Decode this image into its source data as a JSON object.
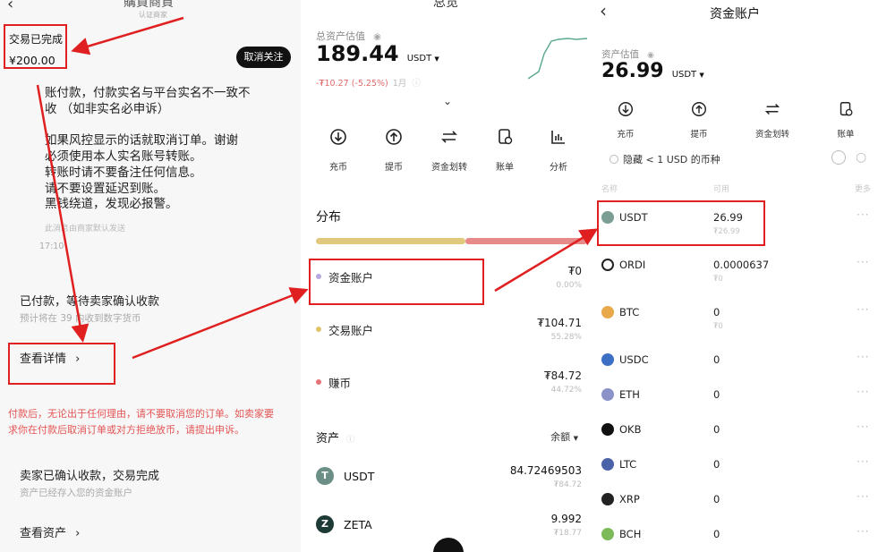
{
  "panel1": {
    "header_title": "購買商資",
    "header_sub": "认证商家",
    "status_text": "交易已完成",
    "amount": "¥200.00",
    "unfollow_label": "取消关注",
    "chat_lines": [
      "账付款，付款实名与平台实名不一致不",
      "收 （如非实名必申诉）",
      "",
      "如果风控显示的话就取消订单。谢谢",
      "必须使用本人实名账号转账。",
      "转账时请不要备注任何信息。",
      "请不要设置延迟到账。",
      "黑钱绕道，发现必报警。"
    ],
    "chat_auto_note": "此消息由商家默认发送",
    "chat_time": "17:10",
    "paid_title": "已付款，等待卖家确认收款",
    "paid_sub": "预计将在 39 内收到数字货币",
    "view_details": "查看详情",
    "warning_line1": "付款后，无论出于任何理由，请不要取消您的订单。如卖家要",
    "warning_line2": "求你在付款后取消订单或对方拒绝放币，请提出申诉。",
    "complete_title": "卖家已确认收款，交易完成",
    "complete_sub": "资产已经存入您的资金账户",
    "view_assets": "查看资产"
  },
  "panel2": {
    "header_title": "总览",
    "est_label": "总资产估值",
    "total": "189.44",
    "unit": "USDT",
    "change": "-₮10.27 (-5.25%)",
    "period": "1月",
    "actions": [
      {
        "label": "充币",
        "icon": "deposit-icon"
      },
      {
        "label": "提币",
        "icon": "withdraw-icon"
      },
      {
        "label": "资金划转",
        "icon": "transfer-icon"
      },
      {
        "label": "账单",
        "icon": "bill-icon"
      },
      {
        "label": "分析",
        "icon": "analysis-icon"
      }
    ],
    "distribution_title": "分布",
    "distribution_split": 0.55,
    "accounts": [
      {
        "name": "资金账户",
        "value": "₮0",
        "pct": "0.00%",
        "color": "#b8a8e0"
      },
      {
        "name": "交易账户",
        "value": "₮104.71",
        "pct": "55.28%",
        "color": "#e0c46a"
      },
      {
        "name": "赚币",
        "value": "₮84.72",
        "pct": "44.72%",
        "color": "#e57373"
      }
    ],
    "assets_title": "资产",
    "sort_label": "余额",
    "assets": [
      {
        "symbol": "USDT",
        "amount": "84.72469503",
        "sub": "₮84.72",
        "color": "#6b8f86"
      },
      {
        "symbol": "ZETA",
        "amount": "9.992",
        "sub": "₮18.77",
        "color": "#1e3a36"
      }
    ]
  },
  "panel3": {
    "header_title": "资金账户",
    "est_label": "资产估值",
    "total": "26.99",
    "unit": "USDT",
    "actions": [
      {
        "label": "充币",
        "icon": "deposit-icon"
      },
      {
        "label": "提币",
        "icon": "withdraw-icon"
      },
      {
        "label": "资金划转",
        "icon": "transfer-icon"
      },
      {
        "label": "账单",
        "icon": "bill-icon"
      }
    ],
    "hide_small": "隐藏 < 1 USD 的币种",
    "col_name": "名称",
    "col_avail": "可用",
    "col_more": "更多",
    "coins": [
      {
        "symbol": "USDT",
        "amount": "26.99",
        "sub": "₮26.99",
        "color": "#7a9e94"
      },
      {
        "symbol": "ORDI",
        "amount": "0.0000637",
        "sub": "₮0",
        "color": "#222222"
      },
      {
        "symbol": "BTC",
        "amount": "0",
        "sub": "₮0",
        "color": "#e8a94a"
      },
      {
        "symbol": "USDC",
        "amount": "0",
        "sub": "",
        "color": "#3d6fc4"
      },
      {
        "symbol": "ETH",
        "amount": "0",
        "sub": "",
        "color": "#8a92c8"
      },
      {
        "symbol": "OKB",
        "amount": "0",
        "sub": "",
        "color": "#111111"
      },
      {
        "symbol": "LTC",
        "amount": "0",
        "sub": "",
        "color": "#4a63a8"
      },
      {
        "symbol": "XRP",
        "amount": "0",
        "sub": "",
        "color": "#222222"
      },
      {
        "symbol": "BCH",
        "amount": "0",
        "sub": "",
        "color": "#7dba5a"
      }
    ]
  },
  "colors": {
    "annotation": "#e02020"
  }
}
